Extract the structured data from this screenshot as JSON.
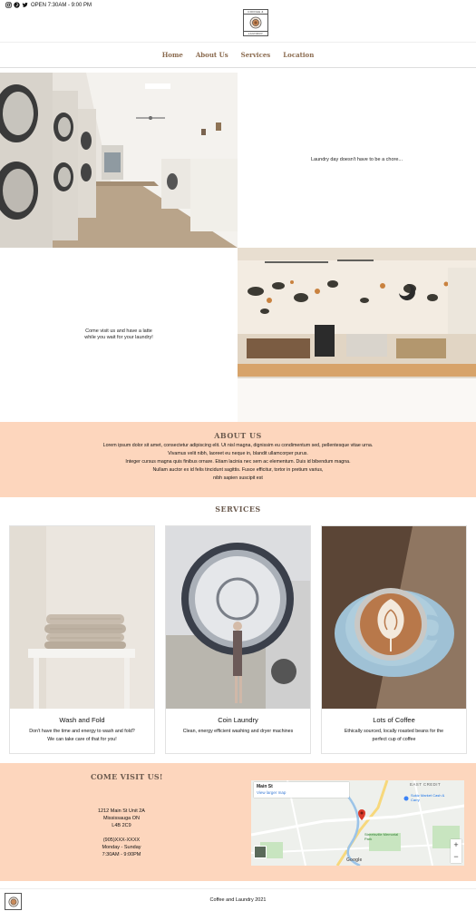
{
  "topbar": {
    "social": [
      "instagram-icon",
      "pinterest-icon",
      "twitter-icon"
    ],
    "hours": "OPEN 7:30AM - 9:00 PM"
  },
  "logo": {
    "top": "COFFEE &",
    "bottom": "LAUNDRY"
  },
  "nav": {
    "items": [
      "Home",
      "About Us",
      "Services",
      "Location"
    ]
  },
  "hero": {
    "caption_1": "Laundry day doesn't have to be a chore...",
    "caption_2_line1": "Come visit us and have a latte",
    "caption_2_line2": "while you wait for your laundry!"
  },
  "about": {
    "title": "ABOUT US",
    "lines": [
      "Lorem ipsum dolor sit amet, consectetur adipiscing elit. Ut nisl magna, dignissim eu condimentum sed, pellentesque vitae urna.",
      "Vivamus velit nibh, laoreet eu neque in, blandit ullamcorper purus.",
      "Integer cursus magna quis finibus ornare. Etiam lacinia nec sem ac elementum. Duis id bibendum magna.",
      "Nullam auctor ex id felis tincidunt sagittis. Fusce efficitur, tortor in pretium varius,",
      "nibh sapien suscipit est"
    ]
  },
  "services": {
    "title": "SERVICES",
    "cards": [
      {
        "title": "Wash and Fold",
        "desc_1": "Don't have the time and energy to wash and fold?",
        "desc_2": "We can take care of that for you!"
      },
      {
        "title": "Coin Laundry",
        "desc_1": "Clean, energy efficient washing and dryer machines",
        "desc_2": ""
      },
      {
        "title": "Lots of Coffee",
        "desc_1": "Ethically sourced, locally roasted beans for the",
        "desc_2": "perfect cup of coffee"
      }
    ]
  },
  "visit": {
    "title": "COME VISIT US!",
    "address": [
      "1212 Main St Unit 2A",
      "Mississauga ON",
      "L4B 2C9"
    ],
    "contact": [
      "(905)XXX-XXXX",
      "Monday - Sunday",
      "7:30AM - 9:00PM"
    ],
    "map": {
      "place": "Main St",
      "link": "View larger map",
      "labels": [
        "EAST CREDIT",
        "Sukiz Market Cash & Carry",
        "Streetsville Memorial Park",
        "Google"
      ],
      "zoom_in": "+",
      "zoom_out": "−"
    }
  },
  "footer": {
    "text": "Coffee and Laundry 2021"
  },
  "colors": {
    "accent_bg": "#fdd6bd",
    "heading": "#6b5a4e",
    "nav": "#8a6a4e"
  }
}
